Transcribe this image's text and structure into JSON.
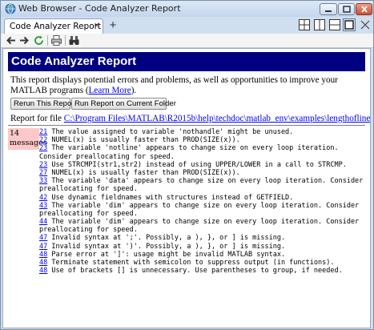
{
  "window": {
    "title": "Web Browser - Code Analyzer Report",
    "icon": "globe-icon"
  },
  "tabs": [
    {
      "label": "Code Analyzer Report",
      "close": "×"
    }
  ],
  "new_tab": "+",
  "report": {
    "title": "Code Analyzer Report",
    "description_prefix": "This report displays potential errors and problems, as well as opportunities to improve your MATLAB programs (",
    "learn_more": "Learn More",
    "description_suffix": ").",
    "rerun_button": "Rerun This Report",
    "run_folder_button": "Run Report on Current Folder",
    "report_for_label": "Report for file",
    "file_path": "C:\\Program Files\\MATLAB\\R2015b\\help\\techdoc\\matlab_env\\examples\\lengthofline.m",
    "count": "14",
    "count_label": "messages"
  },
  "messages": [
    {
      "line": "21",
      "text": " The value assigned to variable 'nothandle' might be unused."
    },
    {
      "line": "22",
      "text": " NUMEL(x) is usually faster than PROD(SIZE(x))."
    },
    {
      "line": "23",
      "text": " The variable 'notline' appears to change size on every loop iteration."
    },
    {
      "line": "",
      "text": "Consider preallocating for speed."
    },
    {
      "line": "23",
      "text": " Use STRCMPI(str1,str2) instead of using UPPER/LOWER in a call to STRCMP."
    },
    {
      "line": "27",
      "text": " NUMEL(x) is usually faster than PROD(SIZE(x))."
    },
    {
      "line": "33",
      "text": " The variable 'data' appears to change size on every loop iteration. Consider"
    },
    {
      "line": "",
      "text": "preallocating for speed."
    },
    {
      "line": "42",
      "text": " Use dynamic fieldnames with structures instead of GETFIELD."
    },
    {
      "line": "43",
      "text": " The variable 'dim' appears to change size on every loop iteration. Consider"
    },
    {
      "line": "",
      "text": "preallocating for speed."
    },
    {
      "line": "44",
      "text": " The variable 'dim' appears to change size on every loop iteration. Consider"
    },
    {
      "line": "",
      "text": "preallocating for speed."
    },
    {
      "line": "47",
      "text": " Invalid syntax at ';'. Possibly, a ), }, or ] is missing."
    },
    {
      "line": "47",
      "text": " Invalid syntax at ')'. Possibly, a ), }, or ] is missing."
    },
    {
      "line": "48",
      "text": " Parse error at ']': usage might be invalid MATLAB syntax."
    },
    {
      "line": "48",
      "text": " Terminate statement with semicolon to suppress output (in functions)."
    },
    {
      "line": "48",
      "text": " Use of brackets [] is unnecessary. Use parentheses to group, if needed."
    }
  ],
  "colors": {
    "header_bg": "#000080",
    "count_bg": "#ffc8c8",
    "link": "#0000ee"
  }
}
